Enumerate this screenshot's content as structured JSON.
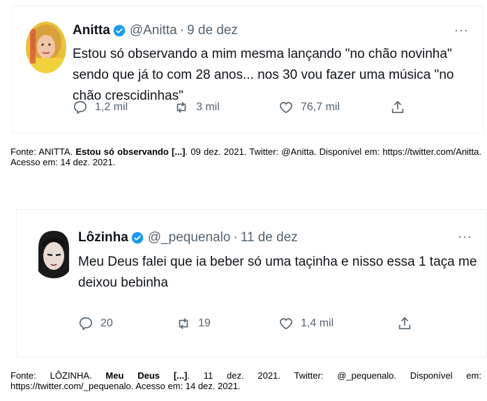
{
  "tweets": [
    {
      "name": "Anitta",
      "handle": "@Anitta",
      "dot": "·",
      "date": "9 de dez",
      "more": "···",
      "text": "Estou só observando a mim mesma lançando \"no chão novinha\" sendo que já to com 28 anos... nos 30 vou fazer uma música \"no chão crescidinhas\"",
      "replies": "1,2 mil",
      "retweets": "3 mil",
      "likes": "76,7 mil"
    },
    {
      "name": "Lôzinha",
      "handle": "@_pequenalo",
      "dot": "·",
      "date": "11 de dez",
      "more": "···",
      "text": "Meu Deus falei que ia beber só uma taçinha e nisso essa 1 taça me deixou bebinha",
      "replies": "20",
      "retweets": "19",
      "likes": "1,4 mil"
    }
  ],
  "captions": [
    {
      "prefix": "Fonte: ANITTA. ",
      "title": "Estou só observando [...]",
      "suffix": ". 09 dez. 2021. Twitter: @Anitta. Disponível em: https://twitter.com/Anitta. Acesso em: 14 dez. 2021."
    },
    {
      "prefix": "Fonte: LÔZINHA. ",
      "title": "Meu Deus [...]",
      "suffix": ". 11 dez. 2021. Twitter: @_pequenalo. Disponível em: https://twitter.com/_pequenalo. Acesso em: 14 dez. 2021."
    }
  ],
  "colors": {
    "verified": "#1d9bf0",
    "muted": "#536471",
    "text": "#0f1419"
  },
  "icons": [
    "verified-badge-icon",
    "reply-icon",
    "retweet-icon",
    "like-icon",
    "share-icon",
    "more-icon"
  ]
}
